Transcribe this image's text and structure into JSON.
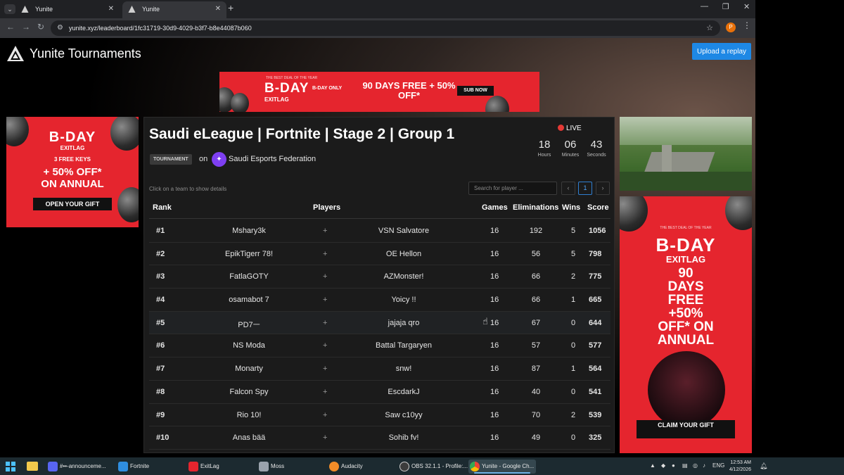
{
  "browser": {
    "tabs": [
      {
        "label": "Yunite",
        "active": false
      },
      {
        "label": "Yunite",
        "active": true
      }
    ],
    "url": "yunite.xyz/leaderboard/1fc31719-30d9-4029-b3f7-b8e44087b060",
    "profile_initial": "P"
  },
  "site": {
    "logo_text": "Yunite Tournaments",
    "upload_label": "Upload a replay"
  },
  "ads": {
    "top": {
      "line1": "B-DAY",
      "line2": "EXITLAG",
      "tag": "B-DAY ONLY",
      "offer": "90 DAYS FREE + 50% OFF*",
      "cta": "SUB NOW",
      "eyebrow": "THE BEST DEAL OF THE YEAR"
    },
    "left": {
      "line1": "B-DAY",
      "line2": "EXITLAG",
      "keys": "3 FREE KEYS",
      "offer1": "+ 50% OFF*",
      "offer2": "ON ANNUAL",
      "cta": "OPEN YOUR GIFT"
    },
    "right": {
      "eyebrow": "THE BEST DEAL OF THE YEAR",
      "line1": "B-DAY",
      "line2": "EXITLAG",
      "offer1": "90",
      "offer2": "DAYS",
      "offer3": "FREE",
      "offer4": "+50%",
      "offer5": "OFF* ON",
      "offer6": "ANNUAL",
      "cta": "CLAIM YOUR GIFT"
    }
  },
  "tournament": {
    "title": "Saudi eLeague | Fortnite | Stage 2 | Group 1",
    "type_badge": "TOURNAMENT",
    "on_label": "on",
    "org_name": "Saudi Esports Federation",
    "live_label": "LIVE",
    "countdown": [
      {
        "value": "18",
        "unit": "Hours"
      },
      {
        "value": "06",
        "unit": "Minutes"
      },
      {
        "value": "43",
        "unit": "Seconds"
      }
    ],
    "hint": "Click on a team to show details",
    "search_placeholder": "Search for player ...",
    "pagination": {
      "prev": "‹",
      "page": "1",
      "next": "›"
    }
  },
  "table": {
    "headers": {
      "rank": "Rank",
      "players": "Players",
      "games": "Games",
      "eliminations": "Eliminations",
      "wins": "Wins",
      "score": "Score"
    },
    "rows": [
      {
        "rank": "#1",
        "p1": "Mshary3k",
        "p2": "VSN Salvatore",
        "games": "16",
        "elims": "192",
        "wins": "5",
        "score": "1056"
      },
      {
        "rank": "#2",
        "p1": "EpikTigerr 78!",
        "p2": "OE Hellon",
        "games": "16",
        "elims": "56",
        "wins": "5",
        "score": "798"
      },
      {
        "rank": "#3",
        "p1": "FatlaGOTY",
        "p2": "AZMonster!",
        "games": "16",
        "elims": "66",
        "wins": "2",
        "score": "775"
      },
      {
        "rank": "#4",
        "p1": "osamabot 7",
        "p2": "Yoicy !!",
        "games": "16",
        "elims": "66",
        "wins": "1",
        "score": "665"
      },
      {
        "rank": "#5",
        "p1": "PD7ㅡ",
        "p2": "jajaja qro",
        "games": "16",
        "elims": "67",
        "wins": "0",
        "score": "644"
      },
      {
        "rank": "#6",
        "p1": "NS Moda",
        "p2": "Battal Targaryen",
        "games": "16",
        "elims": "57",
        "wins": "0",
        "score": "577"
      },
      {
        "rank": "#7",
        "p1": "Monarty",
        "p2": "snw!",
        "games": "16",
        "elims": "87",
        "wins": "1",
        "score": "564"
      },
      {
        "rank": "#8",
        "p1": "Falcon Spy",
        "p2": "EscdarkJ",
        "games": "16",
        "elims": "40",
        "wins": "0",
        "score": "541"
      },
      {
        "rank": "#9",
        "p1": "Rio 10!",
        "p2": "Saw c10yy",
        "games": "16",
        "elims": "70",
        "wins": "2",
        "score": "539"
      },
      {
        "rank": "#10",
        "p1": "Anas bää",
        "p2": "Sohib fv!",
        "games": "16",
        "elims": "49",
        "wins": "0",
        "score": "325"
      }
    ],
    "plus": "+"
  },
  "taskbar": {
    "items": [
      {
        "label": "#••-announceme...",
        "icon": "discord-icon",
        "color": "#5865f2",
        "active": false
      },
      {
        "label": "Fortnite",
        "icon": "fortnite-icon",
        "color": "#2f8ee0",
        "active": false
      },
      {
        "label": "ExitLag",
        "icon": "exitlag-icon",
        "color": "#e5252e",
        "active": false
      },
      {
        "label": "Moss",
        "icon": "moss-icon",
        "color": "#9aa3ad",
        "active": false
      },
      {
        "label": "Audacity",
        "icon": "audacity-icon",
        "color": "#f28c28",
        "active": false
      },
      {
        "label": "OBS 32.1.1 - Profile:...",
        "icon": "obs-icon",
        "color": "#3c3c3c",
        "active": false
      },
      {
        "label": "Yunite - Google Ch...",
        "icon": "chrome-icon",
        "color": "#4caf50",
        "active": true
      }
    ],
    "lang": "ENG",
    "time": "12:53 AM",
    "date": "4/12/2026"
  }
}
